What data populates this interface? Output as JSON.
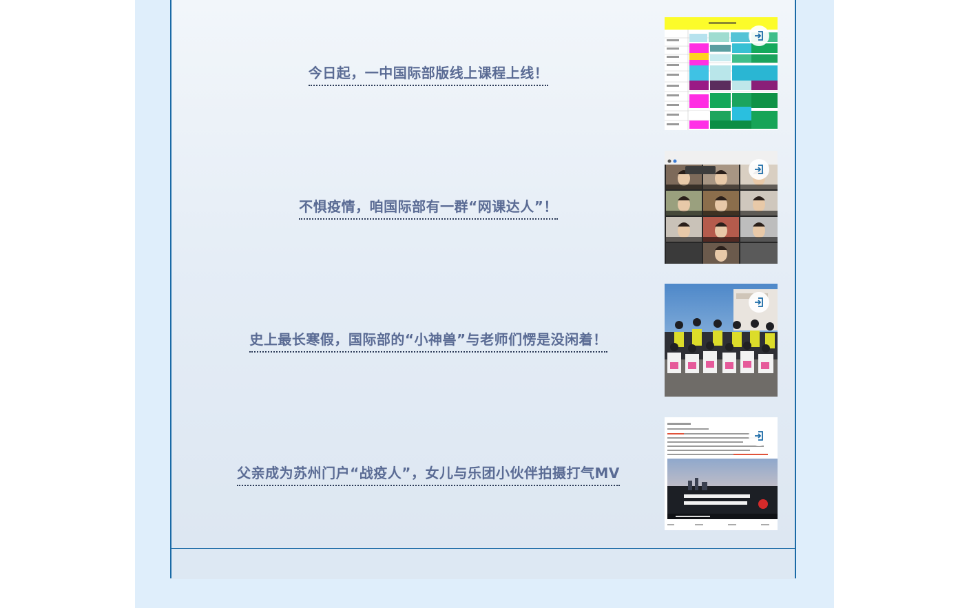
{
  "articles": [
    {
      "title": "今日起，一中国际部版线上课程上线！",
      "thumbnail": "schedule-table",
      "icon": "open-link-icon"
    },
    {
      "title": "不惧疫情，咱国际部有一群“网课达人”！",
      "thumbnail": "video-call-grid",
      "icon": "open-link-icon"
    },
    {
      "title": "史上最长寒假，国际部的“小神兽”与老师们愣是没闲着！",
      "thumbnail": "volunteer-group-photo",
      "icon": "open-link-icon"
    },
    {
      "title": "父亲成为苏州门户“战疫人”，女儿与乐团小伙伴拍摄打气MV",
      "thumbnail": "weibo-video-post",
      "icon": "open-link-icon"
    }
  ],
  "colors": {
    "border": "#1a6aa6",
    "title": "#5a6b94",
    "background": "#dfeefb"
  }
}
